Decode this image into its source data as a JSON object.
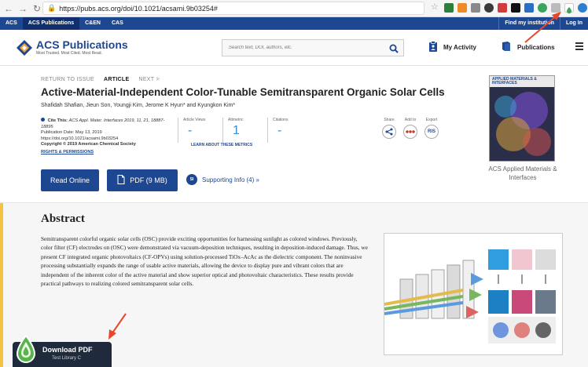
{
  "browser": {
    "url": "https://pubs.acs.org/doi/10.1021/acsami.9b03254#"
  },
  "acs_bar": {
    "items": [
      "ACS",
      "ACS Publications",
      "C&EN",
      "CAS"
    ],
    "institution": "Find my institution",
    "login": "Log In"
  },
  "header": {
    "logo_title": "ACS Publications",
    "logo_tagline": "Most Trusted. Most Cited. Most Read.",
    "search_placeholder": "Search text, DOI, authors, etc.",
    "my_activity": "My Activity",
    "publications": "Publications"
  },
  "article": {
    "nav_return": "RETURN TO ISSUE",
    "nav_article": "ARTICLE",
    "nav_next": "NEXT >",
    "title": "Active-Material-Independent Color-Tunable Semitransparent Organic Solar Cells",
    "authors": "Shafidah Shafian, Jieun Son, Youngji Kim, Jerome K Hyun* and Kyungkon Kim*",
    "cite_label": "Cite This:",
    "cite_text": "ACS Appl. Mater. Interfaces 2019, 11, 21, 18887-18895",
    "pub_date": "Publication Date: May 13, 2019",
    "doi": "https://doi.org/10.1021/acsami.9b03254",
    "copyright": "Copyright © 2019 American Chemical Society",
    "rights": "RIGHTS & PERMISSIONS",
    "metrics": [
      {
        "label": "Article Views",
        "value": "-"
      },
      {
        "label": "Altmetric",
        "value": "1"
      },
      {
        "label": "Citations",
        "value": "-"
      }
    ],
    "learn_more": "LEARN ABOUT THESE METRICS",
    "share_labels": [
      "Share",
      "Add to",
      "Export"
    ],
    "export_label": "RIS",
    "read_online": "Read Online",
    "pdf": "PDF (9 MB)",
    "si_badge": "SI",
    "supporting_info": "Supporting Info (4) »"
  },
  "journal": {
    "cover_title": "APPLIED MATERIALS & INTERFACES",
    "caption": "ACS Applied Materials & Interfaces"
  },
  "abstract": {
    "heading": "Abstract",
    "text": "Semitransparent colorful organic solar cells (OSC) provide exciting opportunities for harnessing sunlight as colored windows. Previously, color filter (CF) electrodes on (OSC) were demonstrated via vacuum-deposition techniques, resulting in deposition-induced damage. Thus, we present CF integrated organic photovoltaics (CF-OPVs) using solution-processed TiOx–AcAc as the dielectric component. The noninvasive processing substantially expands the range of usable active materials, allowing the device to display pure and vibrant colors that are independent of the inherent color of the active material and show superior optical and photovoltaic characteristics. These results provide practical pathways to realizing colored semitransparent solar cells."
  },
  "download_pdf": {
    "title": "Download PDF",
    "subtitle": "Test Library C"
  },
  "colors": {
    "acs_blue": "#1e4791",
    "accent_yellow": "#f3c341",
    "annotation_red": "#e8462a"
  }
}
